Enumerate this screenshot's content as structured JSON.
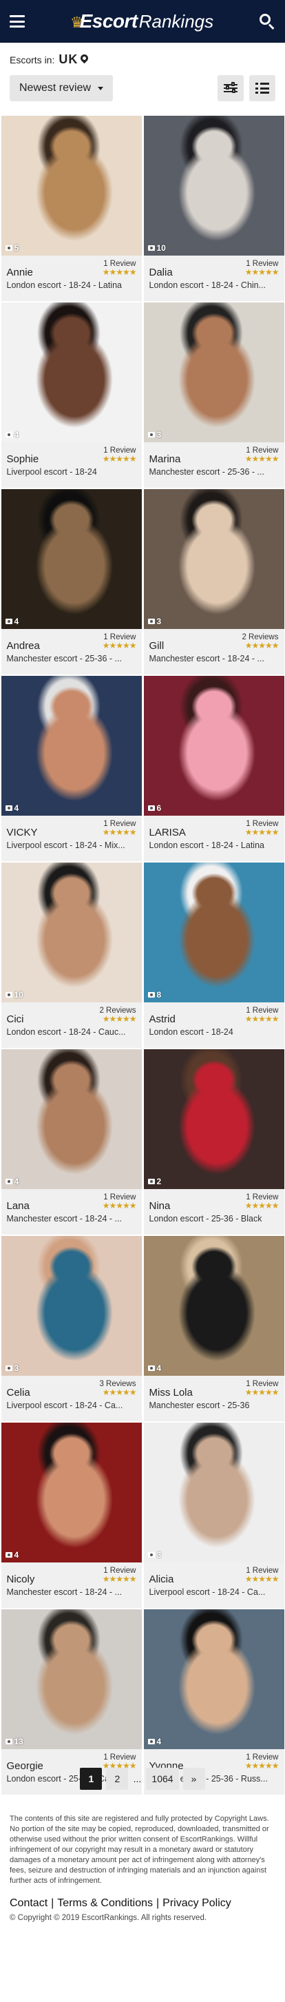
{
  "header": {
    "logo_text_1": "Escort",
    "logo_text_2": "Rankings"
  },
  "location": {
    "label": "Escorts in:",
    "country": "UK"
  },
  "sort": {
    "label": "Newest review"
  },
  "listings": [
    {
      "name": "Annie",
      "reviews": "1 Review",
      "stars": "★★★★★",
      "photos": "5",
      "details": "London escort - 18-24 - Latina",
      "colors": [
        "#e8d9c8",
        "#b88a5a",
        "#3a2a1e"
      ]
    },
    {
      "name": "Dalia",
      "reviews": "1 Review",
      "stars": "★★★★★",
      "photos": "10",
      "details": "London escort - 18-24 - Chin...",
      "colors": [
        "#5a5e66",
        "#d8d2cc",
        "#1e1e22"
      ]
    },
    {
      "name": "Sophie",
      "reviews": "1 Review",
      "stars": "★★★★★",
      "photos": "4",
      "details": "Liverpool escort - 18-24",
      "colors": [
        "#f2f2f2",
        "#6b4230",
        "#1a1210"
      ]
    },
    {
      "name": "Marina",
      "reviews": "1 Review",
      "stars": "★★★★★",
      "photos": "3",
      "details": "Manchester escort - 25-36 - ...",
      "colors": [
        "#d8d4cc",
        "#b07a58",
        "#222"
      ]
    },
    {
      "name": "Andrea",
      "reviews": "1 Review",
      "stars": "★★★★★",
      "photos": "4",
      "details": "Manchester escort - 25-36 - ...",
      "colors": [
        "#2a2218",
        "#8a6a4a",
        "#0e0e0e"
      ]
    },
    {
      "name": "Gill",
      "reviews": "2 Reviews",
      "stars": "★★★★★",
      "photos": "3",
      "details": "Manchester escort - 18-24 - ...",
      "colors": [
        "#6a5a4e",
        "#e0c8b0",
        "#1e1a18"
      ]
    },
    {
      "name": "VICKY",
      "reviews": "1 Review",
      "stars": "★★★★★",
      "photos": "4",
      "details": "Liverpool escort - 18-24 - Mix...",
      "colors": [
        "#2a3a5a",
        "#c88a6a",
        "#e0e0e0"
      ]
    },
    {
      "name": "LARISA",
      "reviews": "1 Review",
      "stars": "★★★★★",
      "photos": "6",
      "details": "London escort - 18-24 - Latina",
      "colors": [
        "#7a2030",
        "#f0a0b0",
        "#3a1a1a"
      ]
    },
    {
      "name": "Cici",
      "reviews": "2 Reviews",
      "stars": "★★★★★",
      "photos": "10",
      "details": "London escort - 18-24 - Cauc...",
      "colors": [
        "#e8dcd0",
        "#c09070",
        "#1a1a1a"
      ]
    },
    {
      "name": "Astrid",
      "reviews": "1 Review",
      "stars": "★★★★★",
      "photos": "8",
      "details": "London escort - 18-24",
      "colors": [
        "#3a8ab0",
        "#8a5a3a",
        "#f0f0f0"
      ]
    },
    {
      "name": "Lana",
      "reviews": "1 Review",
      "stars": "★★★★★",
      "photos": "4",
      "details": "Manchester escort - 18-24 - ...",
      "colors": [
        "#d8d0c8",
        "#b08060",
        "#2a1e18"
      ]
    },
    {
      "name": "Nina",
      "reviews": "1 Review",
      "stars": "★★★★★",
      "photos": "2",
      "details": "London escort - 25-36 - Black",
      "colors": [
        "#3a2a28",
        "#c02030",
        "#5a3a2a"
      ]
    },
    {
      "name": "Celia",
      "reviews": "3 Reviews",
      "stars": "★★★★★",
      "photos": "3",
      "details": "Liverpool escort - 18-24 - Ca...",
      "colors": [
        "#e0c8b8",
        "#2a6a8a",
        "#d0a080"
      ]
    },
    {
      "name": "Miss Lola",
      "reviews": "1 Review",
      "stars": "★★★★★",
      "photos": "4",
      "details": "Manchester escort - 25-36",
      "colors": [
        "#a08868",
        "#1a1a1a",
        "#d8c0a0"
      ]
    },
    {
      "name": "Nicoly",
      "reviews": "1 Review",
      "stars": "★★★★★",
      "photos": "4",
      "details": "Manchester escort - 18-24 - ...",
      "colors": [
        "#8a1a1a",
        "#d09070",
        "#1a1212"
      ]
    },
    {
      "name": "Alicia",
      "reviews": "1 Review",
      "stars": "★★★★★",
      "photos": "3",
      "details": "Liverpool escort - 18-24 - Ca...",
      "colors": [
        "#eeeeee",
        "#c8a890",
        "#222"
      ]
    },
    {
      "name": "Georgie",
      "reviews": "1 Review",
      "stars": "★★★★★",
      "photos": "13",
      "details": "London escort - 25-36 - Cauc...",
      "colors": [
        "#d0ccc8",
        "#c09878",
        "#2a2622"
      ]
    },
    {
      "name": "Yvonne",
      "reviews": "1 Review",
      "stars": "★★★★★",
      "photos": "4",
      "details": "London escort - 25-36 - Russ...",
      "colors": [
        "#5a6e80",
        "#d8b090",
        "#121212"
      ]
    }
  ],
  "pagination": {
    "page_1": "1",
    "page_2": "2",
    "ellipsis": "...",
    "last": "1064",
    "next": "»"
  },
  "footer": {
    "legal": "The contents of this site are registered and fully protected by Copyright Laws. No portion of the site may be copied, reproduced, downloaded, transmitted or otherwise used without the prior written consent of EscortRankings. Willful infringement of our copyright may result in a monetary award or statutory damages of a monetary amount per act of infringement along with attorney's fees, seizure and destruction of infringing materials and an injunction against further acts of infringement.",
    "contact": "Contact",
    "sep": "|",
    "terms": "Terms & Conditions",
    "privacy": "Privacy Policy",
    "copyright": "© Copyright © 2019 EscortRankings. All rights reserved."
  }
}
